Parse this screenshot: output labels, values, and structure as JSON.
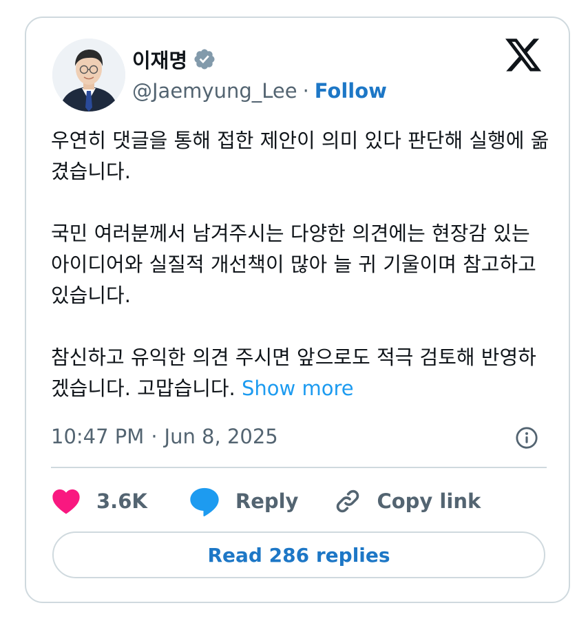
{
  "author": {
    "name": "이재명",
    "handle": "@Jaemyung_Lee",
    "separator": "·",
    "follow_label": "Follow",
    "verified": true,
    "verified_color": "#829aab"
  },
  "icons": {
    "brand": "x-logo-icon",
    "verified": "verified-badge-icon",
    "info": "info-icon",
    "like": "heart-icon",
    "reply": "speech-bubble-icon",
    "copy": "link-icon"
  },
  "post": {
    "paragraphs": [
      "우연히 댓글을 통해 접한 제안이 의미 있다 판단해 실행에 옮겼습니다.",
      "국민 여러분께서 남겨주시는 다양한 의견에는 현장감 있는 아이디어와 실질적 개선책이 많아 늘 귀 기울이며 참고하고 있습니다.",
      "참신하고 유익한 의견 주시면 앞으로도 적극 검토해 반영하겠습니다. 고맙습니다."
    ],
    "show_more": "Show more",
    "time": "10:47 PM",
    "date_separator": "·",
    "date": "Jun 8, 2025"
  },
  "actions": {
    "like_count": "3.6K",
    "reply_label": "Reply",
    "copy_label": "Copy link"
  },
  "footer": {
    "read_replies": "Read 286 replies"
  },
  "colors": {
    "link_blue": "#1d77c6",
    "show_more_blue": "#1d9bf0",
    "like_pink": "#f91880",
    "reply_blue": "#1d9bf0",
    "muted": "#536471",
    "border": "#cfd9de"
  }
}
